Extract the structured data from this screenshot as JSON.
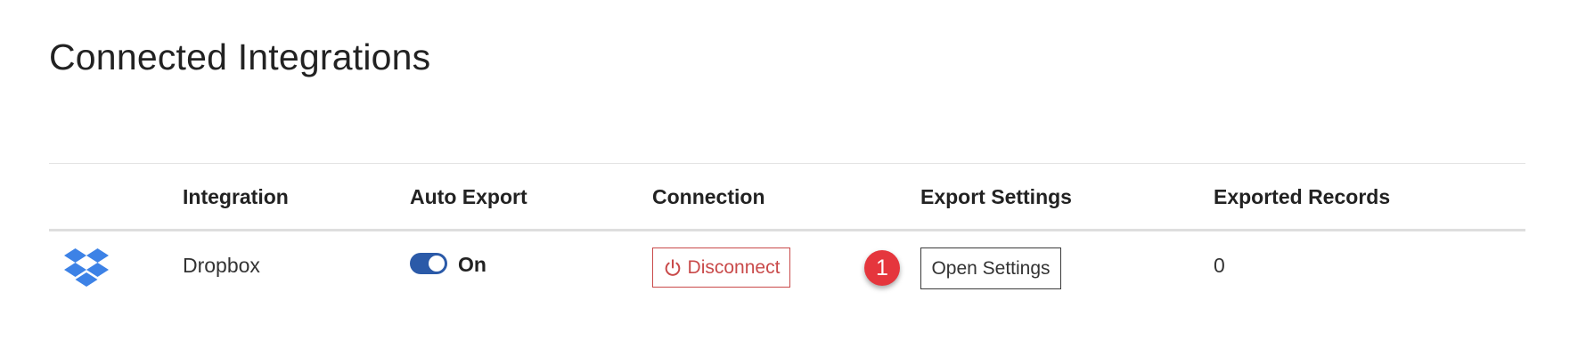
{
  "page": {
    "title": "Connected Integrations"
  },
  "table": {
    "headers": {
      "integration": "Integration",
      "auto_export": "Auto Export",
      "connection": "Connection",
      "export_settings": "Export Settings",
      "exported_records": "Exported Records"
    },
    "rows": [
      {
        "icon": "dropbox-icon",
        "integration": "Dropbox",
        "auto_export": {
          "enabled": true,
          "label": "On"
        },
        "connection": {
          "button_label": "Disconnect",
          "icon": "power-icon"
        },
        "step_badge": "1",
        "export_settings": {
          "button_label": "Open Settings"
        },
        "exported_records": "0"
      }
    ]
  },
  "colors": {
    "toggle_on": "#2b5aa8",
    "disconnect": "#c94a4a",
    "badge": "#e5363d",
    "dropbox_brand": "#3d82e6"
  }
}
